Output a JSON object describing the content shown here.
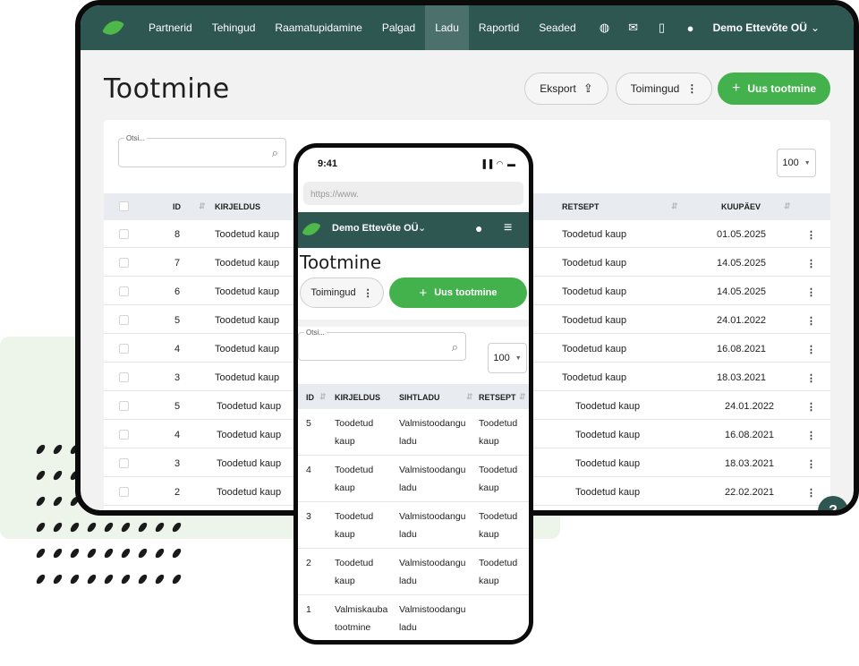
{
  "desktop": {
    "nav": {
      "items": [
        {
          "label": "Partnerid",
          "active": false
        },
        {
          "label": "Tehingud",
          "active": false
        },
        {
          "label": "Raamatupidamine",
          "active": false
        },
        {
          "label": "Palgad",
          "active": false
        },
        {
          "label": "Ladu",
          "active": true
        },
        {
          "label": "Raportid",
          "active": false
        },
        {
          "label": "Seaded",
          "active": false
        }
      ],
      "icons": [
        "globe-icon",
        "mail-icon",
        "document-icon",
        "user-icon"
      ],
      "company": "Demo Ettevõte OÜ"
    },
    "title": "Tootmine",
    "actions": {
      "export_label": "Eksport",
      "actions_label": "Toimingud",
      "new_label": "Uus tootmine"
    },
    "search": {
      "placeholder": "Otsi..."
    },
    "per_page": "100",
    "columns": [
      "ID",
      "KIRJELDUS",
      "RETSEPT",
      "KUUPÄEV"
    ],
    "rows": [
      {
        "id": "8",
        "description": "Toodetud kaup",
        "recipe": "Toodetud kaup",
        "date": "01.05.2025"
      },
      {
        "id": "7",
        "description": "Toodetud kaup",
        "recipe": "Toodetud kaup",
        "date": "14.05.2025"
      },
      {
        "id": "6",
        "description": "Toodetud kaup",
        "recipe": "Toodetud kaup",
        "date": "14.05.2025"
      },
      {
        "id": "5",
        "description": "Toodetud kaup",
        "recipe": "Toodetud kaup",
        "date": "24.01.2022"
      },
      {
        "id": "4",
        "description": "Toodetud kaup",
        "recipe": "Toodetud kaup",
        "date": "16.08.2021"
      },
      {
        "id": "3",
        "description": "Toodetud kaup",
        "recipe": "Toodetud kaup",
        "date": "18.03.2021"
      },
      {
        "id": "5",
        "description": "Toodetud kaup",
        "recipe": "Toodetud kaup",
        "date": "24.01.2022"
      },
      {
        "id": "4",
        "description": "Toodetud kaup",
        "recipe": "Toodetud kaup",
        "date": "16.08.2021"
      },
      {
        "id": "3",
        "description": "Toodetud kaup",
        "recipe": "Toodetud kaup",
        "date": "18.03.2021"
      },
      {
        "id": "2",
        "description": "Toodetud kaup",
        "recipe": "Toodetud kaup",
        "date": "22.02.2021"
      }
    ],
    "help_label": "?"
  },
  "phone": {
    "time": "9:41",
    "url_placeholder": "https://www.",
    "company": "Demo Ettevõte OÜ",
    "title": "Tootmine",
    "actions_label": "Toimingud",
    "new_label": "Uus tootmine",
    "search_placeholder": "Otsi...",
    "per_page": "100",
    "columns": [
      "ID",
      "KIRJELDUS",
      "SIHTLADU",
      "RETSEPT"
    ],
    "rows": [
      {
        "id": "5",
        "description": "Toodetud kaup",
        "warehouse": "Valmistoodangu ladu",
        "recipe": "Toodetud kaup"
      },
      {
        "id": "4",
        "description": "Toodetud kaup",
        "warehouse": "Valmistoodangu ladu",
        "recipe": "Toodetud kaup"
      },
      {
        "id": "3",
        "description": "Toodetud kaup",
        "warehouse": "Valmistoodangu ladu",
        "recipe": "Toodetud kaup"
      },
      {
        "id": "2",
        "description": "Toodetud kaup",
        "warehouse": "Valmistoodangu ladu",
        "recipe": "Toodetud kaup"
      },
      {
        "id": "1",
        "description": "Valmiskauba tootmine",
        "warehouse": "Valmistoodangu ladu",
        "recipe": ""
      }
    ]
  },
  "colors": {
    "nav_bg": "#2f5752",
    "nav_active": "#4c716c",
    "primary_green": "#44b24c",
    "leaf_green": "#4fb84a",
    "decor_bg": "#edf5ea"
  }
}
